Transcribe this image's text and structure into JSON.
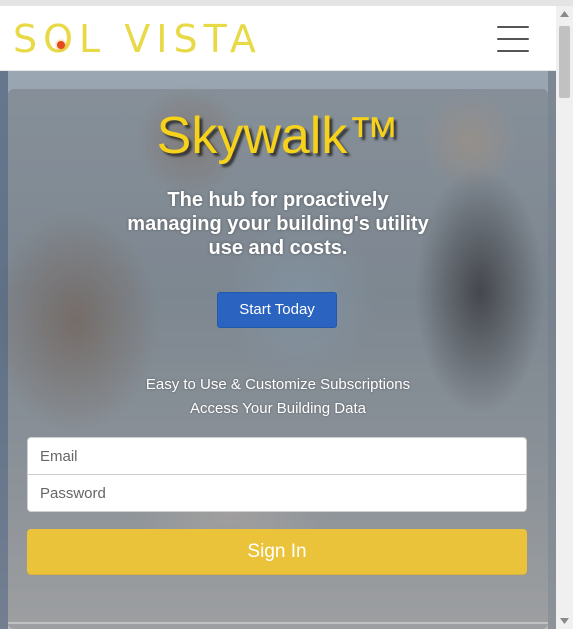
{
  "brand": {
    "logo_part1": "S",
    "logo_o": "O",
    "logo_part2": "L VISTA",
    "color": "#e8da47",
    "dot_color": "#e44a1f"
  },
  "nav": {
    "menu_icon": "hamburger-menu-icon"
  },
  "hero": {
    "title": "Skywalk™",
    "tagline": "The hub for proactively managing your building's utility use and costs.",
    "cta_label": "Start Today",
    "features": [
      "Easy to Use & Customize Subscriptions",
      "Access Your Building Data"
    ],
    "title_color": "#f6d21b",
    "cta_color": "#2a63c0"
  },
  "login": {
    "email_placeholder": "Email",
    "email_value": "",
    "password_placeholder": "Password",
    "password_value": "",
    "signin_label": "Sign In",
    "signin_color": "#ebc33b"
  },
  "scrollbar": {
    "up_icon": "scroll-up-arrow-icon",
    "down_icon": "scroll-down-arrow-icon"
  }
}
